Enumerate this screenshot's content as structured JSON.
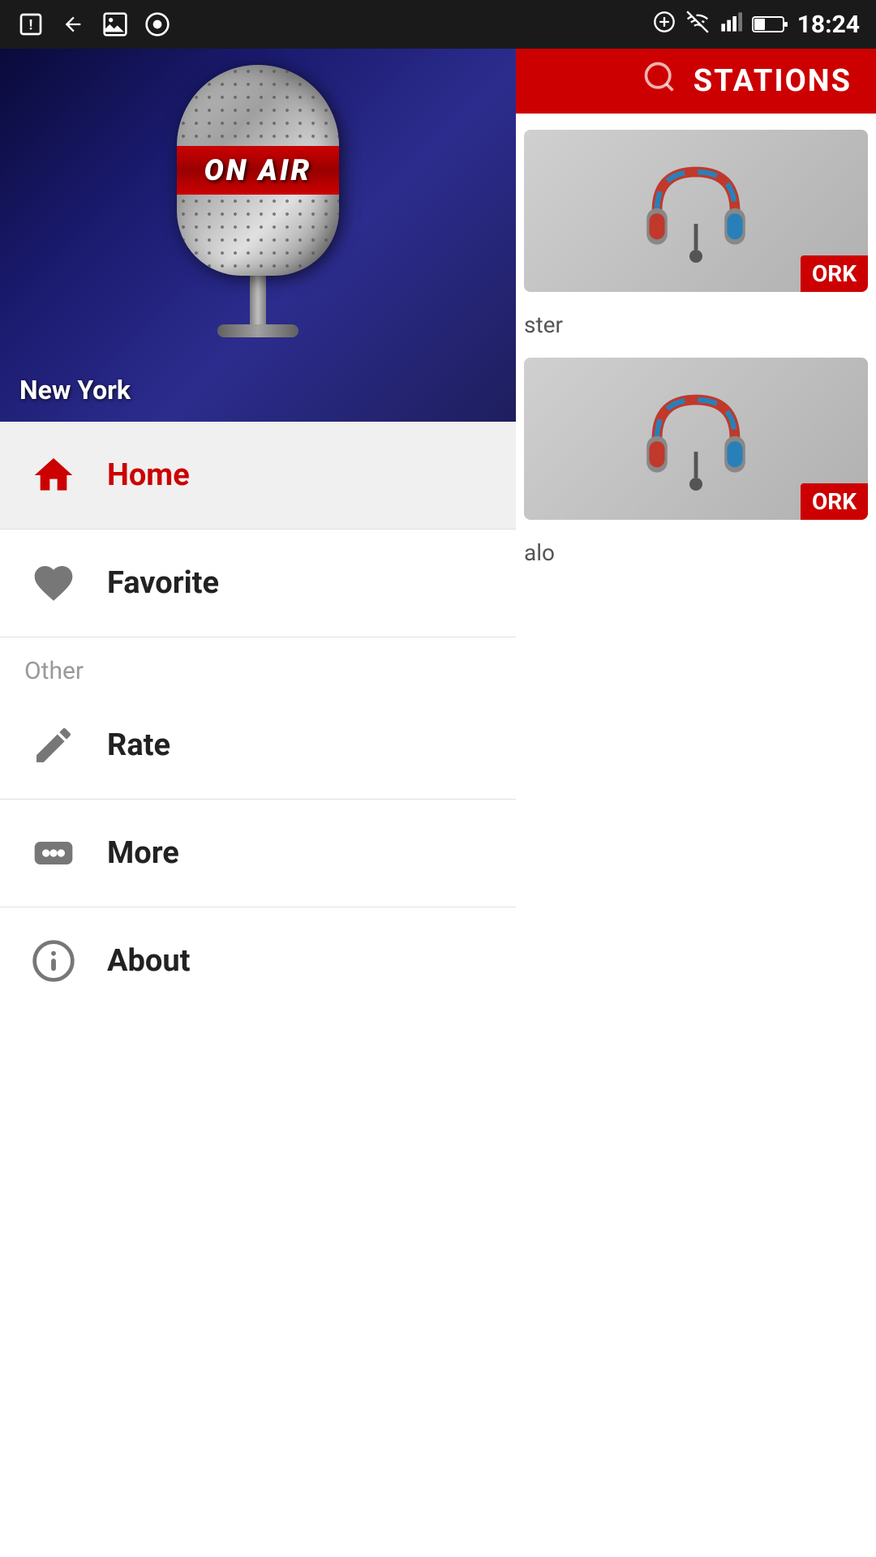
{
  "statusBar": {
    "time": "18:24",
    "battery": "37%"
  },
  "rightPanel": {
    "title": "STATIONS",
    "stations": [
      {
        "label": "ORK",
        "subtitle": "ster"
      },
      {
        "label": "ORK",
        "subtitle": "alo"
      }
    ]
  },
  "hero": {
    "micText": "ON AIR",
    "location": "New York"
  },
  "menu": {
    "items": [
      {
        "id": "home",
        "label": "Home",
        "active": true
      },
      {
        "id": "favorite",
        "label": "Favorite",
        "active": false
      }
    ],
    "sectionOther": "Other",
    "otherItems": [
      {
        "id": "rate",
        "label": "Rate",
        "active": false
      },
      {
        "id": "more",
        "label": "More",
        "active": false
      },
      {
        "id": "about",
        "label": "About",
        "active": false
      }
    ]
  }
}
